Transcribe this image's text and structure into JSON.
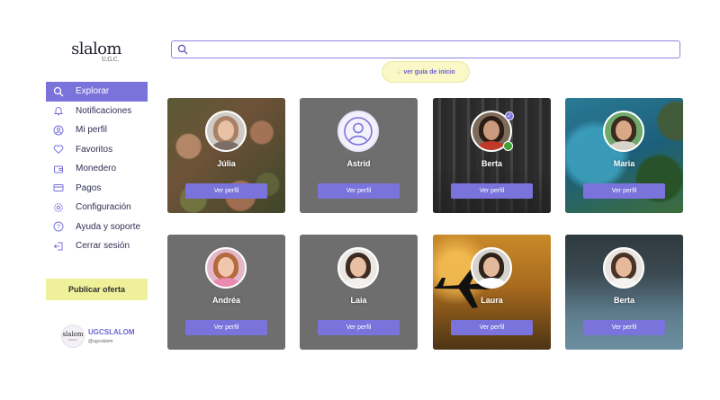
{
  "brand": {
    "name": "slalom",
    "sub": "U.G.C."
  },
  "search": {
    "placeholder": "",
    "value": ""
  },
  "guide": {
    "icon": "pointing-hand-icon",
    "label": "ver guía de inicio"
  },
  "sidebar": {
    "items": [
      {
        "label": "Explorar",
        "icon": "search-icon",
        "active": true
      },
      {
        "label": "Notificaciones",
        "icon": "bell-icon",
        "active": false
      },
      {
        "label": "Mi perfil",
        "icon": "user-circle-icon",
        "active": false
      },
      {
        "label": "Favoritos",
        "icon": "heart-icon",
        "active": false
      },
      {
        "label": "Monedero",
        "icon": "wallet-icon",
        "active": false
      },
      {
        "label": "Pagos",
        "icon": "credit-card-icon",
        "active": false
      },
      {
        "label": "Configuración",
        "icon": "gear-icon",
        "active": false
      },
      {
        "label": "Ayuda y soporte",
        "icon": "help-icon",
        "active": false
      },
      {
        "label": "Cerrar sesión",
        "icon": "logout-icon",
        "active": false
      }
    ],
    "publish_label": "Publicar oferta"
  },
  "account": {
    "avatar_text": "slalom",
    "avatar_sub": "U.G.C.",
    "name": "UGCSLALOM",
    "handle": "@ugcslalom"
  },
  "cards": [
    {
      "name": "Júlia",
      "button": "Ver perfil",
      "verified": false,
      "online": false
    },
    {
      "name": "Astrid",
      "button": "Ver perfil",
      "verified": false,
      "online": false
    },
    {
      "name": "Berta",
      "button": "Ver perfil",
      "verified": true,
      "online": true
    },
    {
      "name": "Maria",
      "button": "Ver perfil",
      "verified": false,
      "online": false
    },
    {
      "name": "Andréa",
      "button": "Ver perfil",
      "verified": false,
      "online": false
    },
    {
      "name": "Laia",
      "button": "Ver perfil",
      "verified": false,
      "online": false
    },
    {
      "name": "Laura",
      "button": "Ver perfil",
      "verified": false,
      "online": false
    },
    {
      "name": "Berta",
      "button": "Ver perfil",
      "verified": false,
      "online": false
    }
  ],
  "colors": {
    "accent": "#7b73dc",
    "publish_bg": "#eef19a",
    "guide_bg": "#fbf8c8",
    "card_gray": "#6e6e6e",
    "online": "#3fa336"
  }
}
